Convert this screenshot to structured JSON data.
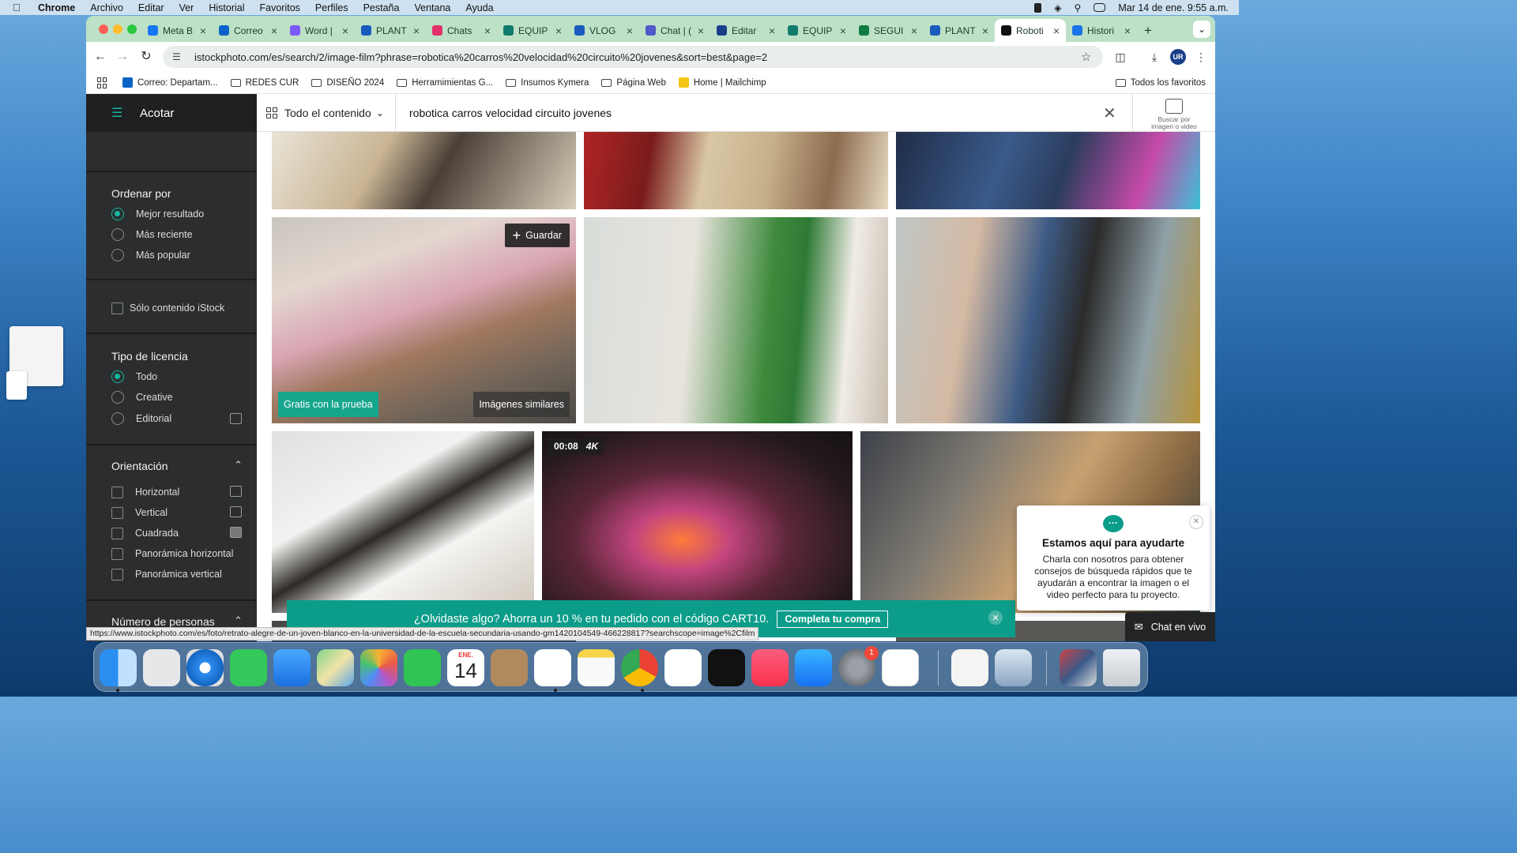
{
  "menubar": {
    "app": "Chrome",
    "items": [
      "Archivo",
      "Editar",
      "Ver",
      "Historial",
      "Favoritos",
      "Perfiles",
      "Pestaña",
      "Ventana",
      "Ayuda"
    ],
    "datetime": "Mar 14 de ene.  9:55 a.m."
  },
  "browser": {
    "tabs": [
      {
        "label": "Meta B",
        "color": "#1877f2"
      },
      {
        "label": "Correo",
        "color": "#0a64c8"
      },
      {
        "label": "Word |",
        "color": "#7a5af8"
      },
      {
        "label": "PLANT",
        "color": "#185abd"
      },
      {
        "label": "Chats",
        "color": "#e1306c"
      },
      {
        "label": "EQUIP",
        "color": "#0f7b6c"
      },
      {
        "label": "VLOG",
        "color": "#185abd"
      },
      {
        "label": "Chat | (",
        "color": "#5059c9"
      },
      {
        "label": "Editar",
        "color": "#1a3f8a"
      },
      {
        "label": "EQUIP",
        "color": "#0f7b6c"
      },
      {
        "label": "SEGUI",
        "color": "#107c41"
      },
      {
        "label": "PLANT",
        "color": "#185abd"
      },
      {
        "label": "Roboti",
        "color": "#111111",
        "active": true
      },
      {
        "label": "Histori",
        "color": "#1a73e8"
      }
    ],
    "url": "istockphoto.com/es/search/2/image-film?phrase=robotica%20carros%20velocidad%20circuito%20jovenes&sort=best&page=2",
    "profile_initials": "UR",
    "bookmarks": [
      {
        "label": "Correo: Departam...",
        "type": "site"
      },
      {
        "label": "REDES CUR",
        "type": "folder"
      },
      {
        "label": "DISEÑO 2024",
        "type": "folder"
      },
      {
        "label": "Herramimientas G...",
        "type": "folder"
      },
      {
        "label": "Insumos Kymera",
        "type": "folder"
      },
      {
        "label": "Página Web",
        "type": "folder"
      },
      {
        "label": "Home | Mailchimp",
        "type": "site"
      }
    ],
    "all_bookmarks": "Todos los favoritos",
    "status_url": "https://www.istockphoto.com/es/foto/retrato-alegre-de-un-joven-blanco-en-la-universidad-de-la-escuela-secundaria-usando-gm1420104549-466228817?searchscope=image%2Cfilm"
  },
  "sidebar": {
    "header": "Acotar",
    "sort": {
      "title": "Ordenar por",
      "options": [
        "Mejor resultado",
        "Más reciente",
        "Más popular"
      ],
      "selected": "Mejor resultado"
    },
    "istock_only": "Sólo contenido iStock",
    "license": {
      "title": "Tipo de licencia",
      "options": [
        "Todo",
        "Creative",
        "Editorial"
      ],
      "selected": "Todo"
    },
    "orientation": {
      "title": "Orientación",
      "options": [
        "Horizontal",
        "Vertical",
        "Cuadrada",
        "Panorámica horizontal",
        "Panorámica vertical"
      ]
    },
    "people": {
      "title": "Número de personas"
    }
  },
  "search": {
    "content_type": "Todo el contenido",
    "query": "robotica carros velocidad circuito jovenes",
    "image_search_label": "Buscar por imagen o video"
  },
  "results": {
    "save_label": "Guardar",
    "trial_label": "Gratis con la prueba",
    "similar_label": "Imágenes similares",
    "video_duration": "00:08",
    "video_quality": "4K"
  },
  "promo": {
    "text": "¿Olvidaste algo? Ahorra un 10 % en tu pedido con el código CART10.",
    "cta": "Completa tu compra"
  },
  "help": {
    "title": "Estamos aquí para ayudarte",
    "body": "Charla con nosotros para obtener consejos de búsqueda rápidos que te ayudarán a encontrar la imagen o el video perfecto para tu proyecto.",
    "chat_label": "Chat en vivo"
  },
  "dock": {
    "calendar_month": "ENE.",
    "calendar_day": "14",
    "settings_badge": "1"
  }
}
